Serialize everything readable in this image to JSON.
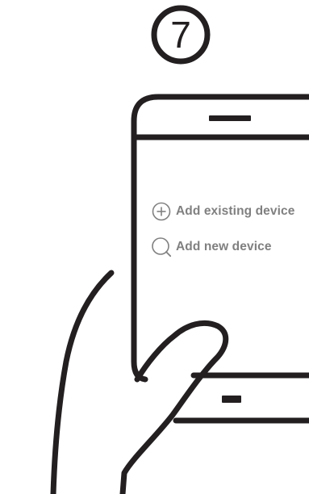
{
  "step": {
    "number": "7"
  },
  "phone_menu": {
    "items": [
      {
        "label": "Add existing device",
        "icon": "plus-circle-icon"
      },
      {
        "label": "Add new device",
        "icon": "magnifier-icon"
      }
    ]
  },
  "colors": {
    "line": "#231f20",
    "menu_text": "#808080",
    "background": "#ffffff"
  }
}
